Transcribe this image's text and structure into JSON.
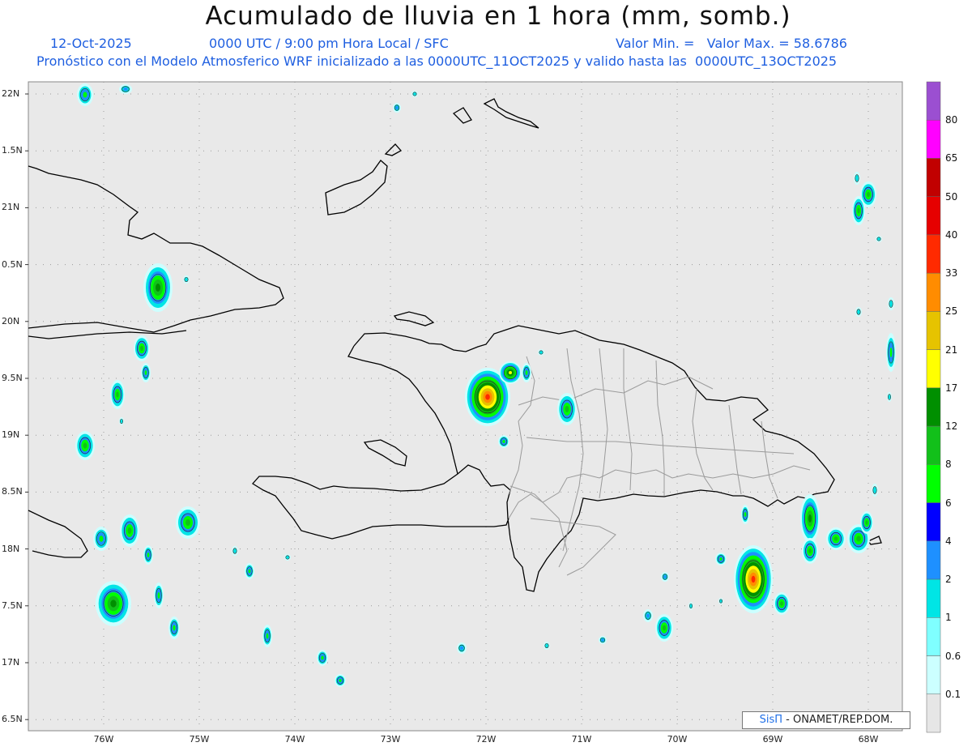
{
  "header": {
    "title": "Acumulado de lluvia en 1 hora (mm, somb.)",
    "date": "12-Oct-2025",
    "time_info": "0000 UTC / 9:00 pm Hora Local / SFC",
    "min_max": "Valor Min. =   Valor Max. = 58.6786",
    "model_info": "Pronóstico con el Modelo Atmosferico WRF inicializado a las 0000UTC_11OCT2025 y valido hasta las  0000UTC_13OCT2025"
  },
  "axes": {
    "lat_labels": [
      "22N",
      "1.5N",
      "21N",
      "0.5N",
      "20N",
      "9.5N",
      "19N",
      "8.5N",
      "18N",
      "7.5N",
      "17N",
      "6.5N"
    ],
    "lon_labels": [
      "76W",
      "75W",
      "74W",
      "73W",
      "72W",
      "71W",
      "70W",
      "69W",
      "68W"
    ]
  },
  "colorbar": {
    "labels": [
      "80",
      "65",
      "50",
      "40",
      "33",
      "25",
      "21",
      "17",
      "12",
      "8",
      "6",
      "4",
      "2",
      "1",
      "0.6",
      "0.1"
    ],
    "colors": [
      "#9b4fd1",
      "#ff00ff",
      "#c10000",
      "#e60000",
      "#ff2a00",
      "#ff8c00",
      "#e6c300",
      "#ffff00",
      "#008f00",
      "#12c01a",
      "#00ff00",
      "#0000ff",
      "#1e90ff",
      "#00e5e5",
      "#7fffff",
      "#ccffff",
      "#e6e6e6"
    ]
  },
  "credit": {
    "logo": "SisΠ",
    "text": "- ONAMET/REP.DOM."
  },
  "map_colors": {
    "background": "#e9e9e9",
    "coast": "#000000",
    "provinces": "#9a9a9a",
    "grid": "#999999"
  }
}
